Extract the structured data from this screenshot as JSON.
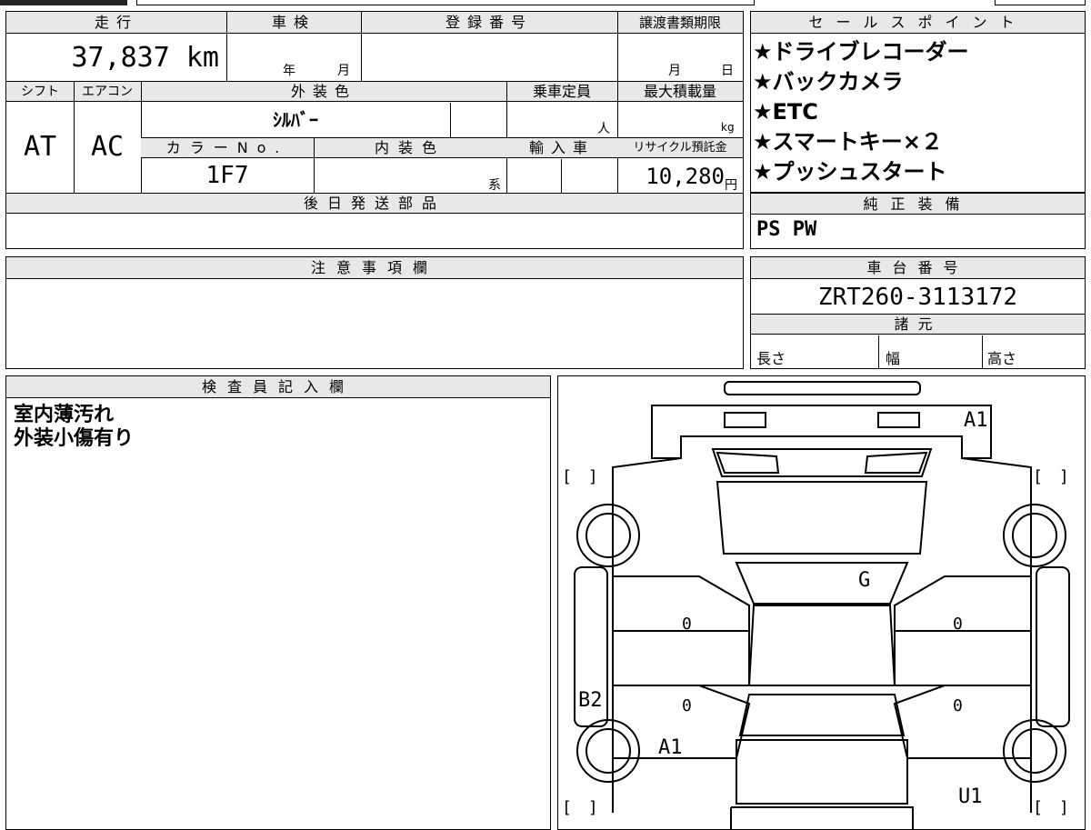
{
  "table": {
    "mileage_header": "走行",
    "mileage_value": "37,837 km",
    "inspection_header": "車検",
    "inspection_year": "年",
    "inspection_month": "月",
    "registration_header": "登録番号",
    "transfer_header": "譲渡書類期限",
    "transfer_month": "月",
    "transfer_day": "日",
    "shift_header": "シフト",
    "shift_value": "AT",
    "aircon_header": "エアコン",
    "aircon_value": "AC",
    "exterior_header": "外装色",
    "exterior_value": "ｼﾙﾊﾞｰ",
    "capacity_header": "乗車定員",
    "capacity_unit": "人",
    "maxload_header": "最大積載量",
    "maxload_unit": "kg",
    "color_no_header": "カラーNo.",
    "color_no_value": "1F7",
    "interior_header": "内装色",
    "interior_unit": "系",
    "import_header": "輸入車",
    "recycle_header": "リサイクル預託金",
    "recycle_value": "10,280",
    "recycle_unit": "円",
    "later_parts_header": "後日発送部品",
    "notes_header": "注意事項欄"
  },
  "sales_points": {
    "header": "セールスポイント",
    "items": [
      "★ドライブレコーダー",
      "★バックカメラ",
      "★ETC",
      "★スマートキー×２",
      "★プッシュスタート"
    ]
  },
  "equipment": {
    "header": "純正装備",
    "value": "PS PW"
  },
  "chassis": {
    "header": "車台番号",
    "value": "ZRT260-3113172"
  },
  "specs": {
    "header": "諸元",
    "length": "長さ",
    "width": "幅",
    "height": "高さ"
  },
  "inspector": {
    "header": "検査員記入欄",
    "lines": [
      "室内薄汚れ",
      "外装小傷有り"
    ]
  },
  "diagram": {
    "marks": {
      "front_right": "A1",
      "windshield": "G",
      "left_front_door": "0",
      "left_rear_door": "0",
      "right_front_door": "0",
      "right_rear_door": "0",
      "left_side": "B2",
      "left_rear": "A1",
      "rear_right": "U1"
    },
    "bracket": "[　]"
  }
}
